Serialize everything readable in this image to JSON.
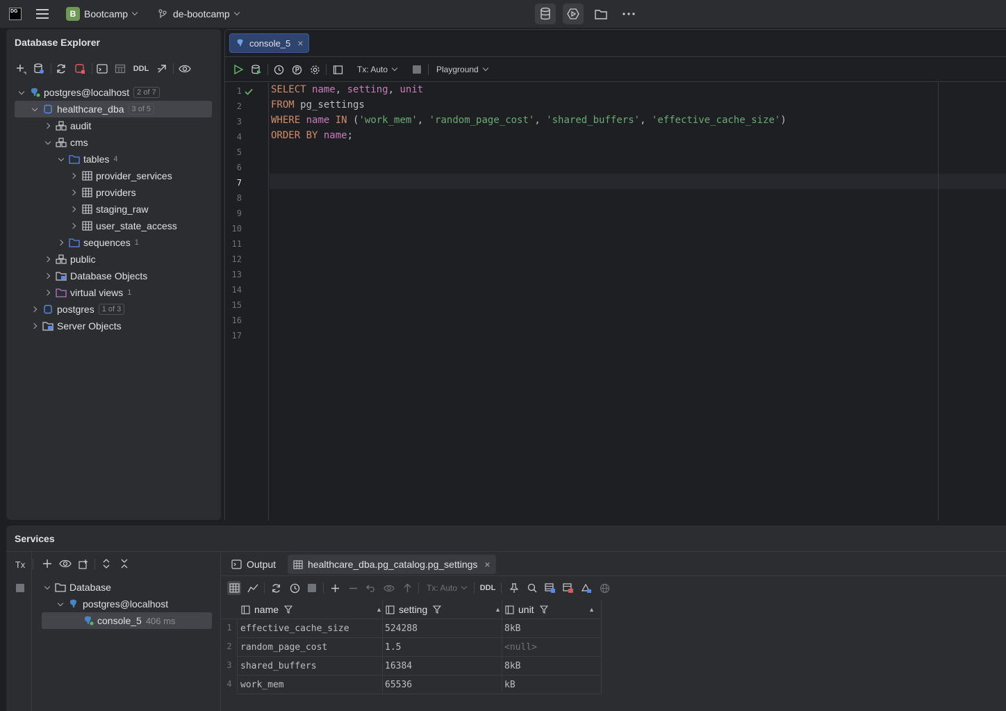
{
  "titlebar": {
    "logo_text": "DG",
    "project_badge": "B",
    "project_name": "Bootcamp",
    "branch": "de-bootcamp"
  },
  "db_explorer": {
    "title": "Database Explorer",
    "toolbar": {
      "ddl_label": "DDL"
    },
    "tree": [
      {
        "label": "postgres@localhost",
        "badge": "2 of 7"
      },
      {
        "label": "healthcare_dba",
        "badge": "3 of 5"
      },
      {
        "label": "audit"
      },
      {
        "label": "cms"
      },
      {
        "label": "tables",
        "count": "4"
      },
      {
        "label": "provider_services"
      },
      {
        "label": "providers"
      },
      {
        "label": "staging_raw"
      },
      {
        "label": "user_state_access"
      },
      {
        "label": "sequences",
        "count": "1"
      },
      {
        "label": "public"
      },
      {
        "label": "Database Objects"
      },
      {
        "label": "virtual views",
        "count": "1"
      },
      {
        "label": "postgres",
        "badge": "1 of 3"
      },
      {
        "label": "Server Objects"
      }
    ]
  },
  "editor": {
    "tab_label": "console_5",
    "tx_label": "Tx: Auto",
    "playground_label": "Playground",
    "line_numbers": [
      "1",
      "2",
      "3",
      "4",
      "5",
      "6",
      "7",
      "8",
      "9",
      "10",
      "11",
      "12",
      "13",
      "14",
      "15",
      "16",
      "17"
    ],
    "code": {
      "l1_kw": "SELECT",
      "l1_a": "name",
      "l1_b": ", ",
      "l1_c": "setting",
      "l1_d": ", ",
      "l1_e": "unit",
      "l2_kw": "FROM",
      "l2_a": " pg_settings",
      "l3_kw": "WHERE",
      "l3_a": "name",
      "l3_kw2": "IN",
      "l3_b": " (",
      "l3_s1": "'work_mem'",
      "l3_c1": ", ",
      "l3_s2": "'random_page_cost'",
      "l3_c2": ", ",
      "l3_s3": "'shared_buffers'",
      "l3_c3": ", ",
      "l3_s4": "'effective_cache_size'",
      "l3_e": ")",
      "l4_kw": "ORDER BY",
      "l4_a": "name",
      "l4_b": ";"
    }
  },
  "services": {
    "title": "Services",
    "tx_label": "Tx",
    "tree": [
      {
        "label": "Database"
      },
      {
        "label": "postgres@localhost"
      },
      {
        "label": "console_5",
        "meta": "406 ms"
      }
    ],
    "tabs": {
      "output": "Output",
      "result": "healthcare_dba.pg_catalog.pg_settings"
    },
    "toolbar": {
      "tx_label": "Tx: Auto",
      "ddl_label": "DDL"
    },
    "grid": {
      "columns": [
        "name",
        "setting",
        "unit"
      ],
      "rows": [
        {
          "n": "1",
          "name": "effective_cache_size",
          "setting": "524288",
          "unit": "8kB"
        },
        {
          "n": "2",
          "name": "random_page_cost",
          "setting": "1.5",
          "unit": "<null>"
        },
        {
          "n": "3",
          "name": "shared_buffers",
          "setting": "16384",
          "unit": "8kB"
        },
        {
          "n": "4",
          "name": "work_mem",
          "setting": "65536",
          "unit": "kB"
        }
      ]
    }
  }
}
